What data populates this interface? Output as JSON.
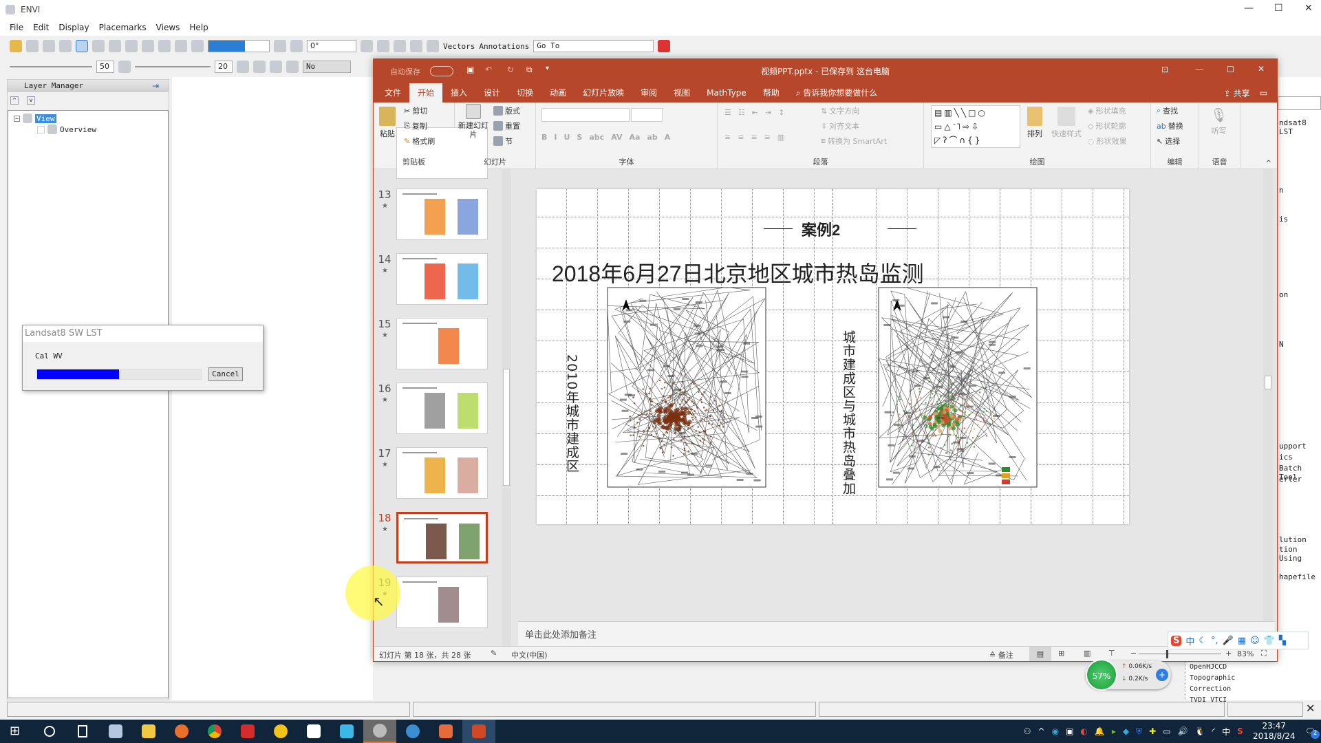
{
  "envi": {
    "title": "ENVI",
    "menu": [
      "File",
      "Edit",
      "Display",
      "Placemarks",
      "Views",
      "Help"
    ],
    "toolbar": {
      "rotation": "0°",
      "vectors": "Vectors",
      "annotations": "Annotations",
      "goto": "Go To",
      "brightness": "50",
      "contrast": "20",
      "stretch": "No stretch"
    },
    "layer_manager": {
      "title": "Layer Manager",
      "tree": [
        {
          "label": "View",
          "selected": true
        },
        {
          "label": "Overview"
        }
      ]
    },
    "toolbox_partial": [
      "ndsat8 LST",
      "n",
      "is",
      "on",
      "N",
      "upport",
      "ics",
      "Batch Tool",
      "erter",
      "lution",
      "tion Using",
      "hapefile",
      "ile"
    ],
    "toolbox_items": [
      "OpenHJCCD",
      "Topographic Correction",
      "TVDI VTCI"
    ]
  },
  "dialog": {
    "title": "Landsat8 SW LST",
    "status": "Cal WV",
    "progress": 0.5,
    "cancel": "Cancel",
    "progress_color": "#0000ff"
  },
  "ppt": {
    "autosave": "自动保存",
    "title": "视频PPT.pptx - 已保存到 这台电脑",
    "tabs": [
      "文件",
      "开始",
      "插入",
      "设计",
      "切换",
      "动画",
      "幻灯片放映",
      "审阅",
      "视图",
      "MathType",
      "帮助"
    ],
    "active_tab": "开始",
    "tell_me": "告诉我你想要做什么",
    "share": "共享",
    "ribbon": {
      "clipboard": {
        "label": "剪贴板",
        "paste": "粘贴",
        "cut": "剪切",
        "copy": "复制",
        "format_painter": "格式刷"
      },
      "slides": {
        "label": "幻灯片",
        "new_slide": "新建幻灯片",
        "layout": "版式",
        "reset": "重置",
        "section": "节"
      },
      "font": {
        "label": "字体"
      },
      "paragraph": {
        "label": "段落",
        "text_direction": "文字方向",
        "align_text": "对齐文本",
        "smartart": "转换为 SmartArt"
      },
      "drawing": {
        "label": "绘图",
        "arrange": "排列",
        "quick_styles": "快速样式",
        "fill": "形状填充",
        "outline": "形状轮廓",
        "effects": "形状效果"
      },
      "editing": {
        "label": "编辑",
        "find": "查找",
        "replace": "替换",
        "select": "选择"
      },
      "voice": {
        "label": "语音",
        "dictate": "听写"
      }
    },
    "thumbnails": [
      {
        "num": "13"
      },
      {
        "num": "14"
      },
      {
        "num": "15"
      },
      {
        "num": "16"
      },
      {
        "num": "17"
      },
      {
        "num": "18",
        "selected": true
      },
      {
        "num": "19"
      }
    ],
    "slide": {
      "case": "案例2",
      "title": "2018年6月27日北京地区城市热岛监测",
      "left_label": "2010年城市建成区",
      "right_label": "城市建成区与城市热岛叠加"
    },
    "notes_placeholder": "单击此处添加备注",
    "status": {
      "slide_info": "幻灯片 第 18 张，共 28 张",
      "language": "中文(中国)",
      "notes": "备注",
      "zoom": "83%",
      "zoom_level": 0.83
    }
  },
  "net_widget": {
    "cpu": "57%",
    "up": "0.06K/s",
    "down": "0.2K/s"
  },
  "taskbar": {
    "time": "23:47",
    "date": "2018/8/24",
    "notifications": "2",
    "ime": "中"
  }
}
